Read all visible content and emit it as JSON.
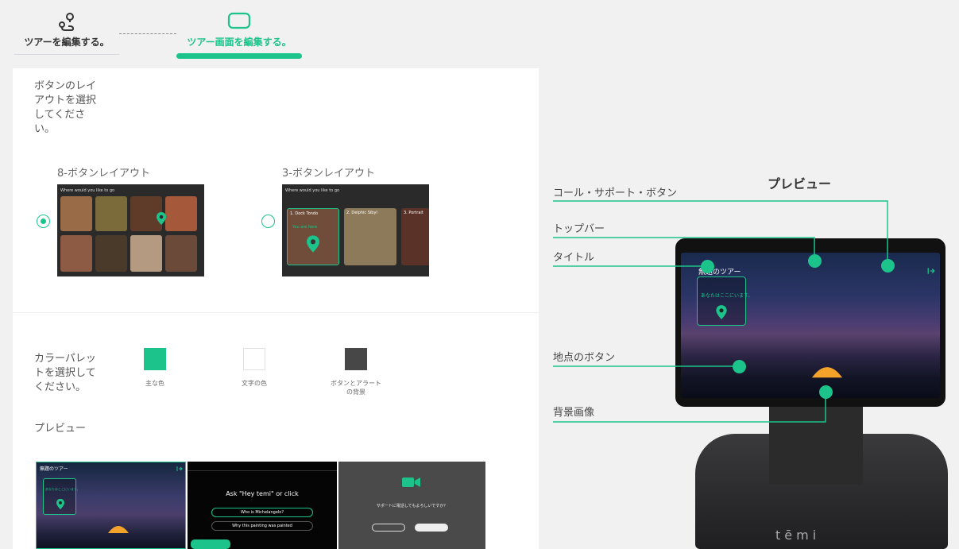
{
  "tabs": {
    "edit_tour": "ツアーを編集する。",
    "edit_tour_screen": "ツアー画面を編集する。"
  },
  "layout_section": {
    "title_lines": [
      "ボタンのレイ",
      "アウトを選択",
      "してくださ",
      "い。"
    ],
    "option_8": "8-ボタンレイアウト",
    "option_3": "3-ボタンレイアウト",
    "selected": "8-ボタンレイアウト",
    "thumb_header": "Where would you like to go",
    "thumb3_cards": [
      "1. Dock Tondo",
      "2. Delphic Sibyl",
      "3. Portrait"
    ],
    "thumb3_marker": "You are here"
  },
  "palette_section": {
    "title_lines": [
      "カラーパレッ",
      "トを選択して",
      "ください。"
    ],
    "swatches": [
      {
        "label": "主な色",
        "color": "#1cc38a"
      },
      {
        "label": "文字の色",
        "color": "#ffffff"
      },
      {
        "label_lines": [
          "ボタンとアラート",
          "の背景"
        ],
        "color": "#474747"
      }
    ]
  },
  "preview_section": {
    "title": "プレビュー",
    "thumb1_title": "無題のツアー",
    "thumb1_here": "あなたはここにいます。",
    "thumb2_prompt": "Ask \"Hey temi\" or click",
    "thumb2_q1": "Who is Michelangelo?",
    "thumb2_q2": "Why this painting was painted",
    "thumb3_question": "サポートに電話してもよろしいですか？"
  },
  "right_panel": {
    "title": "プレビュー",
    "callouts": [
      "コール・サポート・ボタン",
      "トップバー",
      "タイトル",
      "地点のボタン",
      "背景画像"
    ],
    "screen_title": "無題のツアー",
    "screen_here": "あなたはここにいます。",
    "brand": "tēmi"
  },
  "colors": {
    "accent": "#1cc38a"
  }
}
